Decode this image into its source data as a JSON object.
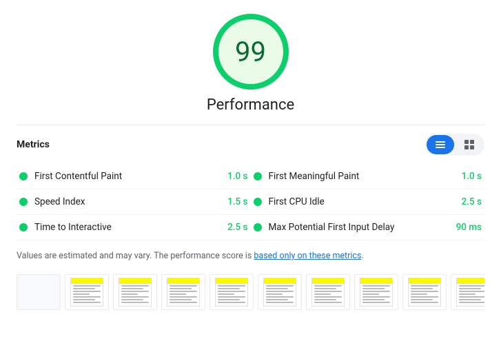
{
  "score": {
    "value": "99",
    "label": "Performance",
    "color": "#0cce6b",
    "bg": "#e9fbe7"
  },
  "metrics_header": {
    "title": "Metrics",
    "toggle_list_label": "list view",
    "toggle_grid_label": "grid view"
  },
  "metrics": [
    {
      "name": "First Contentful Paint",
      "value": "1.0 s",
      "color": "#0cce6b"
    },
    {
      "name": "First Meaningful Paint",
      "value": "1.0 s",
      "color": "#0cce6b"
    },
    {
      "name": "Speed Index",
      "value": "1.5 s",
      "color": "#0cce6b"
    },
    {
      "name": "First CPU Idle",
      "value": "2.5 s",
      "color": "#0cce6b"
    },
    {
      "name": "Time to Interactive",
      "value": "2.5 s",
      "color": "#0cce6b"
    },
    {
      "name": "Max Potential First Input Delay",
      "value": "90 ms",
      "color": "#0cce6b"
    }
  ],
  "note": {
    "text_before": "Values are estimated and may vary. The performance score is ",
    "link_text": "based only on these metrics",
    "text_after": "."
  },
  "filmstrip": {
    "frame_count": 11
  }
}
